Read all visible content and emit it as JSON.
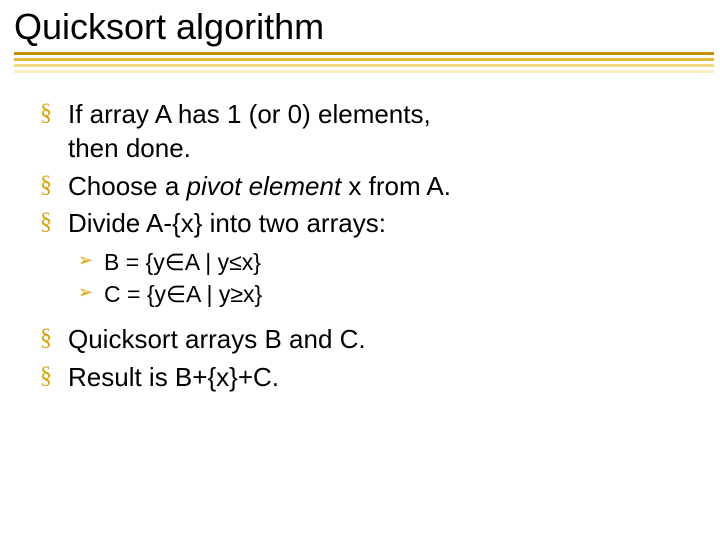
{
  "title": "Quicksort algorithm",
  "bullets": {
    "b1a": "If array A has 1 (or 0) elements,",
    "b1b": "then done.",
    "b2a": "Choose a ",
    "b2_pivot": "pivot element",
    "b2b": " x from A.",
    "b3": "Divide A-{x} into two arrays:",
    "b3_sub1": "B = {y∈A | y≤x}",
    "b3_sub2": "C = {y∈A | y≥x}",
    "b4": "Quicksort arrays B and C.",
    "b5": "Result is B+{x}+C."
  }
}
